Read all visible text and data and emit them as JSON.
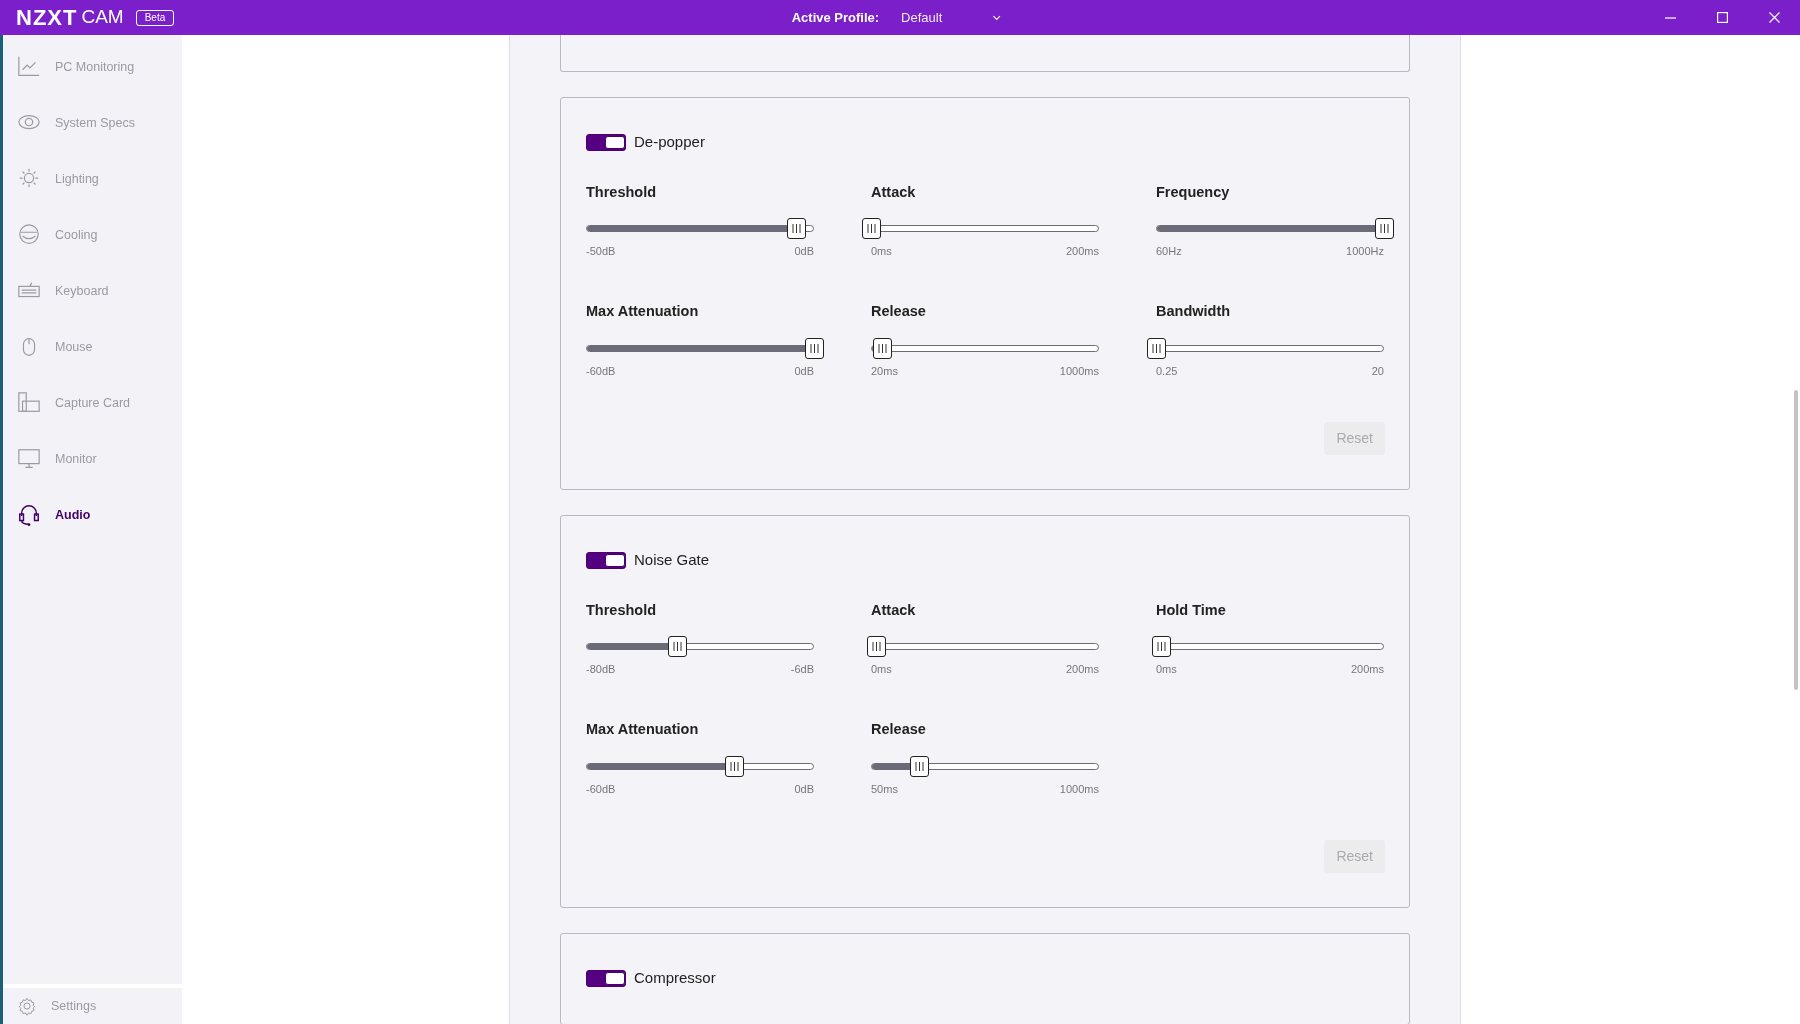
{
  "titlebar": {
    "logo": "NZXT",
    "app": "CAM",
    "badge": "Beta",
    "profile_label": "Active Profile:",
    "profile_value": "Default"
  },
  "sidebar": {
    "items": [
      {
        "label": "PC Monitoring",
        "selected": false
      },
      {
        "label": "System Specs",
        "selected": false
      },
      {
        "label": "Lighting",
        "selected": false
      },
      {
        "label": "Cooling",
        "selected": false
      },
      {
        "label": "Keyboard",
        "selected": false
      },
      {
        "label": "Mouse",
        "selected": false
      },
      {
        "label": "Capture Card",
        "selected": false
      },
      {
        "label": "Monitor",
        "selected": false
      },
      {
        "label": "Audio",
        "selected": true
      }
    ],
    "settings": "Settings"
  },
  "sections": [
    {
      "title": "De-popper",
      "on": true,
      "sliders": [
        {
          "label": "Threshold",
          "min": "-50dB",
          "max": "0dB",
          "level": 0.92
        },
        {
          "label": "Attack",
          "min": "0ms",
          "max": "200ms",
          "level": 0.0
        },
        {
          "label": "Frequency",
          "min": "60Hz",
          "max": "1000Hz",
          "level": 1.0
        },
        {
          "label": "Max Attenuation",
          "min": "-60dB",
          "max": "0dB",
          "level": 1.0
        },
        {
          "label": "Release",
          "min": "20ms",
          "max": "1000ms",
          "level": 0.05
        },
        {
          "label": "Bandwidth",
          "min": "0.25",
          "max": "20",
          "level": 0.0
        }
      ],
      "reset": {
        "label": "Reset",
        "disabled": true
      }
    },
    {
      "title": "Noise Gate",
      "on": true,
      "sliders": [
        {
          "label": "Threshold",
          "min": "-80dB",
          "max": "-6dB",
          "level": 0.4
        },
        {
          "label": "Attack",
          "min": "0ms",
          "max": "200ms",
          "level": 0.02
        },
        {
          "label": "Hold Time",
          "min": "0ms",
          "max": "200ms",
          "level": 0.02
        },
        {
          "label": "Max Attenuation",
          "min": "-60dB",
          "max": "0dB",
          "level": 0.65
        },
        {
          "label": "Release",
          "min": "50ms",
          "max": "1000ms",
          "level": 0.21
        }
      ],
      "reset": {
        "label": "Reset",
        "disabled": true
      }
    },
    {
      "title": "Compressor",
      "on": true
    }
  ]
}
